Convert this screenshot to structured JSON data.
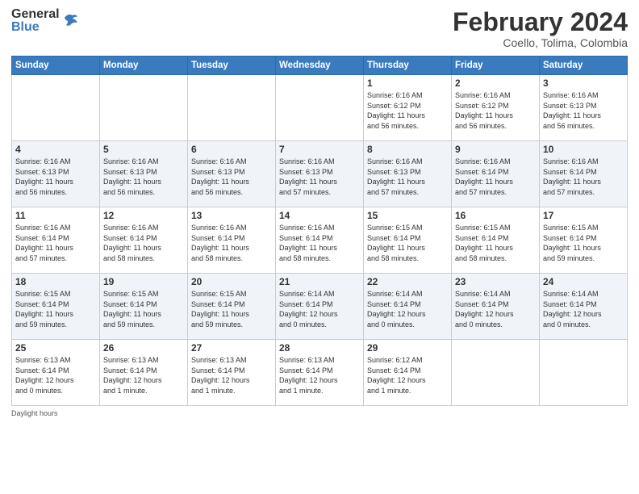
{
  "logo": {
    "general": "General",
    "blue": "Blue"
  },
  "header": {
    "month_year": "February 2024",
    "location": "Coello, Tolima, Colombia"
  },
  "weekdays": [
    "Sunday",
    "Monday",
    "Tuesday",
    "Wednesday",
    "Thursday",
    "Friday",
    "Saturday"
  ],
  "weeks": [
    [
      {
        "day": "",
        "info": ""
      },
      {
        "day": "",
        "info": ""
      },
      {
        "day": "",
        "info": ""
      },
      {
        "day": "",
        "info": ""
      },
      {
        "day": "1",
        "info": "Sunrise: 6:16 AM\nSunset: 6:12 PM\nDaylight: 11 hours\nand 56 minutes."
      },
      {
        "day": "2",
        "info": "Sunrise: 6:16 AM\nSunset: 6:12 PM\nDaylight: 11 hours\nand 56 minutes."
      },
      {
        "day": "3",
        "info": "Sunrise: 6:16 AM\nSunset: 6:13 PM\nDaylight: 11 hours\nand 56 minutes."
      }
    ],
    [
      {
        "day": "4",
        "info": "Sunrise: 6:16 AM\nSunset: 6:13 PM\nDaylight: 11 hours\nand 56 minutes."
      },
      {
        "day": "5",
        "info": "Sunrise: 6:16 AM\nSunset: 6:13 PM\nDaylight: 11 hours\nand 56 minutes."
      },
      {
        "day": "6",
        "info": "Sunrise: 6:16 AM\nSunset: 6:13 PM\nDaylight: 11 hours\nand 56 minutes."
      },
      {
        "day": "7",
        "info": "Sunrise: 6:16 AM\nSunset: 6:13 PM\nDaylight: 11 hours\nand 57 minutes."
      },
      {
        "day": "8",
        "info": "Sunrise: 6:16 AM\nSunset: 6:13 PM\nDaylight: 11 hours\nand 57 minutes."
      },
      {
        "day": "9",
        "info": "Sunrise: 6:16 AM\nSunset: 6:14 PM\nDaylight: 11 hours\nand 57 minutes."
      },
      {
        "day": "10",
        "info": "Sunrise: 6:16 AM\nSunset: 6:14 PM\nDaylight: 11 hours\nand 57 minutes."
      }
    ],
    [
      {
        "day": "11",
        "info": "Sunrise: 6:16 AM\nSunset: 6:14 PM\nDaylight: 11 hours\nand 57 minutes."
      },
      {
        "day": "12",
        "info": "Sunrise: 6:16 AM\nSunset: 6:14 PM\nDaylight: 11 hours\nand 58 minutes."
      },
      {
        "day": "13",
        "info": "Sunrise: 6:16 AM\nSunset: 6:14 PM\nDaylight: 11 hours\nand 58 minutes."
      },
      {
        "day": "14",
        "info": "Sunrise: 6:16 AM\nSunset: 6:14 PM\nDaylight: 11 hours\nand 58 minutes."
      },
      {
        "day": "15",
        "info": "Sunrise: 6:15 AM\nSunset: 6:14 PM\nDaylight: 11 hours\nand 58 minutes."
      },
      {
        "day": "16",
        "info": "Sunrise: 6:15 AM\nSunset: 6:14 PM\nDaylight: 11 hours\nand 58 minutes."
      },
      {
        "day": "17",
        "info": "Sunrise: 6:15 AM\nSunset: 6:14 PM\nDaylight: 11 hours\nand 59 minutes."
      }
    ],
    [
      {
        "day": "18",
        "info": "Sunrise: 6:15 AM\nSunset: 6:14 PM\nDaylight: 11 hours\nand 59 minutes."
      },
      {
        "day": "19",
        "info": "Sunrise: 6:15 AM\nSunset: 6:14 PM\nDaylight: 11 hours\nand 59 minutes."
      },
      {
        "day": "20",
        "info": "Sunrise: 6:15 AM\nSunset: 6:14 PM\nDaylight: 11 hours\nand 59 minutes."
      },
      {
        "day": "21",
        "info": "Sunrise: 6:14 AM\nSunset: 6:14 PM\nDaylight: 12 hours\nand 0 minutes."
      },
      {
        "day": "22",
        "info": "Sunrise: 6:14 AM\nSunset: 6:14 PM\nDaylight: 12 hours\nand 0 minutes."
      },
      {
        "day": "23",
        "info": "Sunrise: 6:14 AM\nSunset: 6:14 PM\nDaylight: 12 hours\nand 0 minutes."
      },
      {
        "day": "24",
        "info": "Sunrise: 6:14 AM\nSunset: 6:14 PM\nDaylight: 12 hours\nand 0 minutes."
      }
    ],
    [
      {
        "day": "25",
        "info": "Sunrise: 6:13 AM\nSunset: 6:14 PM\nDaylight: 12 hours\nand 0 minutes."
      },
      {
        "day": "26",
        "info": "Sunrise: 6:13 AM\nSunset: 6:14 PM\nDaylight: 12 hours\nand 1 minute."
      },
      {
        "day": "27",
        "info": "Sunrise: 6:13 AM\nSunset: 6:14 PM\nDaylight: 12 hours\nand 1 minute."
      },
      {
        "day": "28",
        "info": "Sunrise: 6:13 AM\nSunset: 6:14 PM\nDaylight: 12 hours\nand 1 minute."
      },
      {
        "day": "29",
        "info": "Sunrise: 6:12 AM\nSunset: 6:14 PM\nDaylight: 12 hours\nand 1 minute."
      },
      {
        "day": "",
        "info": ""
      },
      {
        "day": "",
        "info": ""
      }
    ]
  ],
  "footer": {
    "daylight_hours": "Daylight hours"
  }
}
